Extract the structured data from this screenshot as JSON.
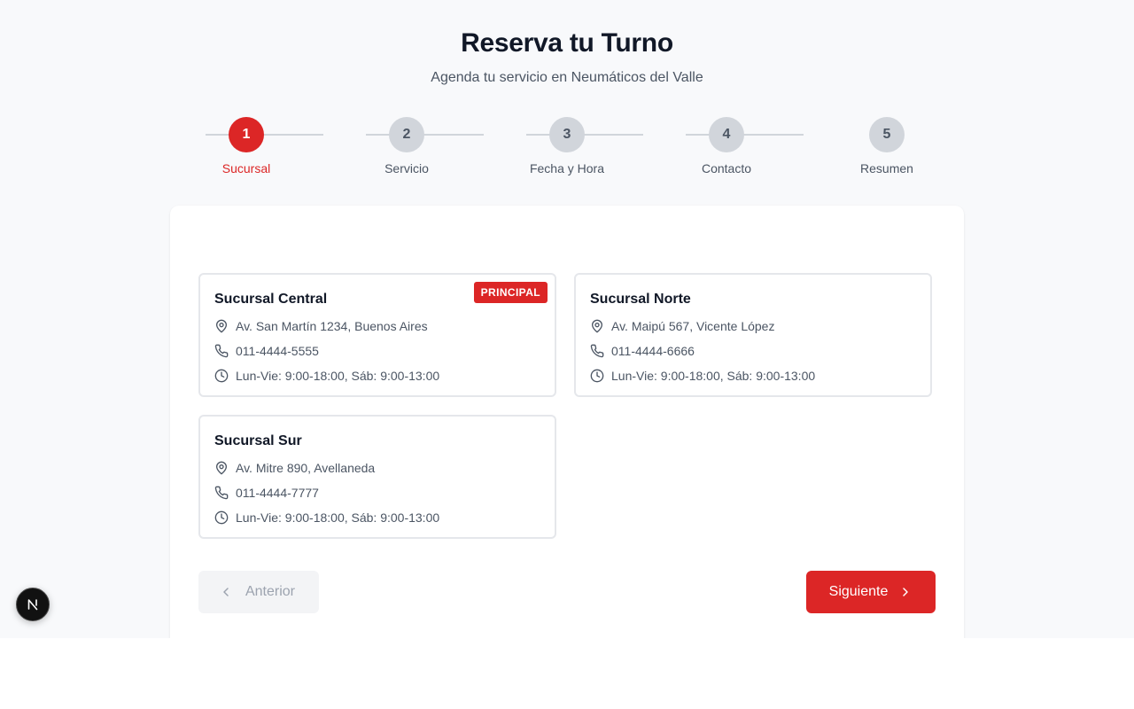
{
  "header": {
    "title": "Reserva tu Turno",
    "subtitle": "Agenda tu servicio en Neumáticos del Valle"
  },
  "steps": [
    {
      "number": "1",
      "label": "Sucursal",
      "active": true
    },
    {
      "number": "2",
      "label": "Servicio",
      "active": false
    },
    {
      "number": "3",
      "label": "Fecha y Hora",
      "active": false
    },
    {
      "number": "4",
      "label": "Contacto",
      "active": false
    },
    {
      "number": "5",
      "label": "Resumen",
      "active": false
    }
  ],
  "branches": [
    {
      "name": "Sucursal Central",
      "badge": "PRINCIPAL",
      "address": "Av. San Martín 1234, Buenos Aires",
      "phone": "011-4444-5555",
      "hours": "Lun-Vie: 9:00-18:00, Sáb: 9:00-13:00"
    },
    {
      "name": "Sucursal Norte",
      "address": "Av. Maipú 567, Vicente López",
      "phone": "011-4444-6666",
      "hours": "Lun-Vie: 9:00-18:00, Sáb: 9:00-13:00"
    },
    {
      "name": "Sucursal Sur",
      "address": "Av. Mitre 890, Avellaneda",
      "phone": "011-4444-7777",
      "hours": "Lun-Vie: 9:00-18:00, Sáb: 9:00-13:00"
    }
  ],
  "navigation": {
    "prev_label": "Anterior",
    "next_label": "Siguiente",
    "prev_icon": "chevron-left-icon",
    "next_icon": "chevron-right-icon"
  },
  "icons": {
    "address": "map-pin-icon",
    "phone": "phone-icon",
    "hours": "clock-icon",
    "dev_badge": "nextjs-logo-icon"
  },
  "colors": {
    "accent": "#dc2626",
    "step_inactive": "#d1d5db",
    "text_muted": "#4b5563",
    "page_bg": "#f8f9fb"
  }
}
